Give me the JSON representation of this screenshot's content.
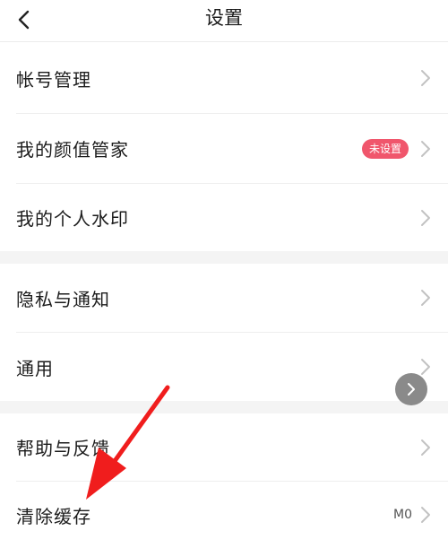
{
  "header": {
    "title": "设置"
  },
  "sections": [
    {
      "items": [
        {
          "label": "帐号管理"
        },
        {
          "label": "我的颜值管家",
          "badge": "未设置"
        },
        {
          "label": "我的个人水印"
        }
      ]
    },
    {
      "items": [
        {
          "label": "隐私与通知"
        },
        {
          "label": "通用"
        }
      ]
    },
    {
      "items": [
        {
          "label": "帮助与反馈"
        },
        {
          "label": "清除缓存",
          "value": "M0"
        }
      ]
    }
  ],
  "colors": {
    "badge": "#f0566c",
    "annotation_arrow": "#f01d1d",
    "section_gap": "#f4f4f4"
  }
}
